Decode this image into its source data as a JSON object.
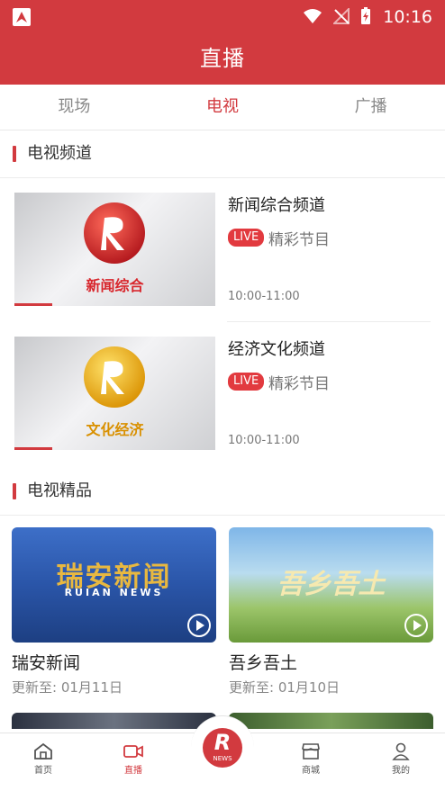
{
  "status_bar": {
    "time": "10:16"
  },
  "header": {
    "title": "直播"
  },
  "tabs": [
    {
      "label": "现场",
      "active": false
    },
    {
      "label": "电视",
      "active": true
    },
    {
      "label": "广播",
      "active": false
    }
  ],
  "sections": {
    "tv_channels": {
      "title": "电视频道"
    },
    "tv_picks": {
      "title": "电视精品"
    }
  },
  "channels": [
    {
      "name": "新闻综合频道",
      "live_badge": "LIVE",
      "program": "精彩节目",
      "time": "10:00-11:00",
      "logo_text": "新闻综合",
      "logo_color": "#d8262c"
    },
    {
      "name": "经济文化频道",
      "live_badge": "LIVE",
      "program": "精彩节目",
      "time": "10:00-11:00",
      "logo_text": "文化经济",
      "logo_color": "#f2b400"
    }
  ],
  "picks": [
    {
      "title": "瑞安新闻",
      "updated": "更新至: 01月11日",
      "cover_text": "瑞安新闻",
      "cover_sub": "RUIAN NEWS"
    },
    {
      "title": "吾乡吾土",
      "updated": "更新至: 01月10日",
      "cover_text": "吾乡吾土"
    }
  ],
  "bottom_nav": {
    "home": "首页",
    "live": "直播",
    "center_big": "R",
    "center_small": "NEWS",
    "mall": "商城",
    "me": "我的"
  },
  "colors": {
    "brand_red": "#d23a3f",
    "live_red": "#e23a3f"
  }
}
